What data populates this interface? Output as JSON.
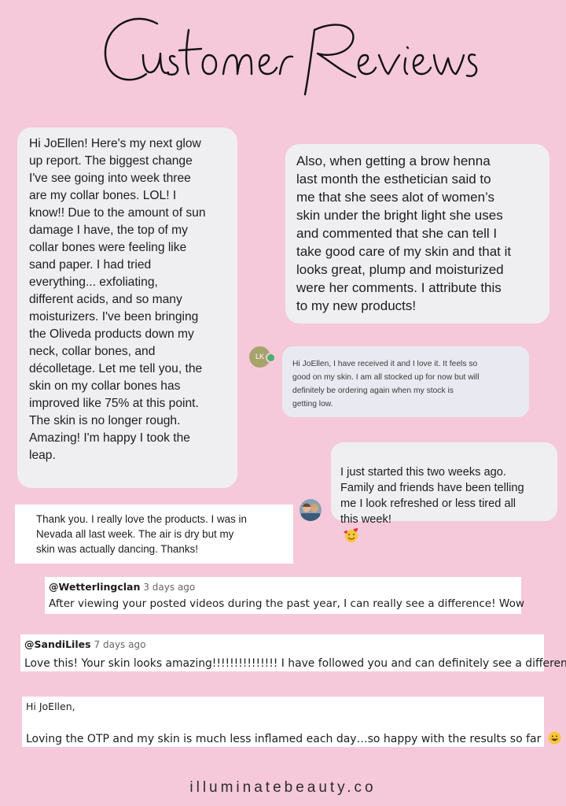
{
  "page": {
    "title": "Customer Reviews",
    "footer": "illuminatebeauty.co",
    "colors": {
      "background": "#f5c9d9",
      "bubble": "#efeff1",
      "card": "#ffffff"
    }
  },
  "reviews": {
    "bubble_left": "Hi JoEllen! Here's my next glow\nup report. The biggest change\nI've see going into week three\nare my collar bones. LOL! I\nknow!! Due to the amount of sun\ndamage I have, the top of my\ncollar bones were feeling like\nsand paper. I had tried\neverything... exfoliating,\ndifferent acids, and so many\nmoisturizers. I've been bringing\nthe Oliveda products down my\nneck, collar bones, and\ndécolletage. Let me tell you, the\nskin on my collar bones has\nimproved like 75% at this point.\nThe skin is no longer rough.\nAmazing! I'm happy I took the\nleap.",
    "bubble_right": "Also, when getting a brow henna\nlast month the esthetician said to\nme that she sees alot of women’s\nskin under the bright light she uses\nand commented that she can tell I\ntake good care of my skin and that it\nlooks great, plump and moisturized\nwere her comments. I attribute this\nto my new products!",
    "lk": {
      "initials": "LK",
      "text": "Hi JoEllen, I have received it and I love it. It feels so\ngood on my skin. I am all stocked up for now but will\ndefinitely be ordering again when my stock is\ngetting low."
    },
    "two_weeks": {
      "text": "I just started this two weeks ago.\nFamily and friends have been telling\nme I look refreshed or less tired all\nthis week!",
      "emoji": "smiling-face-with-hearts"
    },
    "nevada": "Thank you.  I really love the products.  I was in\nNevada all last week.  The air is dry but my\nskin was actually dancing.  Thanks!",
    "wetterling": {
      "handle": "@Wetterlingclan",
      "age": "3 days ago",
      "text": "After viewing your posted videos during the past year, I can really see a difference! Wow"
    },
    "sandi": {
      "handle": "@SandiLiles",
      "age": "7 days ago",
      "text": "Love this!  Your skin looks amazing!!!!!!!!!!!!!!!  I have followed you and can definitely see a difference."
    },
    "otp": {
      "greeting": "Hi JoEllen,",
      "text": "Loving the OTP and my skin is much less inflamed each day…so happy with the results so far",
      "emoji": "grinning-face"
    }
  }
}
